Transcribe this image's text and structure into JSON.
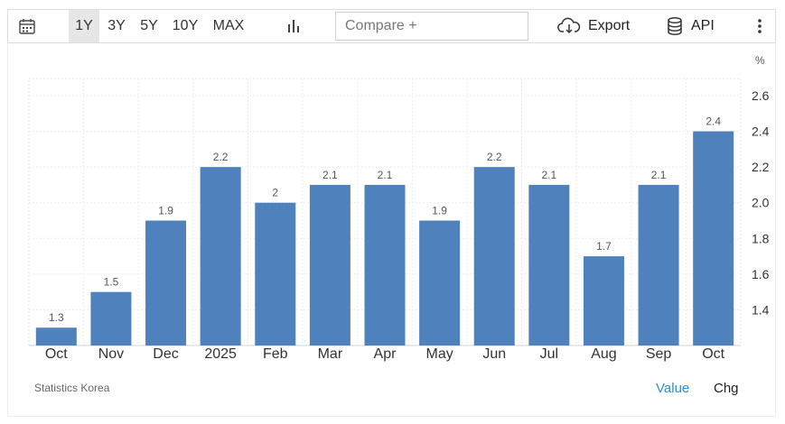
{
  "toolbar": {
    "ranges": [
      "1Y",
      "3Y",
      "5Y",
      "10Y",
      "MAX"
    ],
    "active_range": "1Y",
    "compare_placeholder": "Compare +",
    "export_label": "Export",
    "api_label": "API",
    "icons": [
      "calendar-icon",
      "bar-chart-icon",
      "cloud-download-icon",
      "database-icon",
      "more-vertical-icon"
    ]
  },
  "colors": {
    "bar": "#4f81bd",
    "active_range_bg": "#e6e6e6",
    "value_link": "#2a8fd6"
  },
  "chart_data": {
    "type": "bar",
    "unit": "%",
    "categories": [
      "Oct",
      "Nov",
      "Dec",
      "2025",
      "Feb",
      "Mar",
      "Apr",
      "May",
      "Jun",
      "Jul",
      "Aug",
      "Sep",
      "Oct"
    ],
    "values": [
      1.3,
      1.5,
      1.9,
      2.2,
      2,
      2.1,
      2.1,
      1.9,
      2.2,
      2.1,
      1.7,
      2.1,
      2.4
    ],
    "value_labels": [
      "1.3",
      "1.5",
      "1.9",
      "2.2",
      "2",
      "2.1",
      "2.1",
      "1.9",
      "2.2",
      "2.1",
      "1.7",
      "2.1",
      "2.4"
    ],
    "y_ticks": [
      "1.4",
      "1.6",
      "1.8",
      "2.0",
      "2.2",
      "2.4",
      "2.6"
    ],
    "ylim": [
      1.2,
      2.6
    ],
    "y_axis_position": "right",
    "grid": true,
    "legend": "none"
  },
  "footer": {
    "source": "Statistics Korea",
    "value_label": "Value",
    "chg_label": "Chg"
  }
}
